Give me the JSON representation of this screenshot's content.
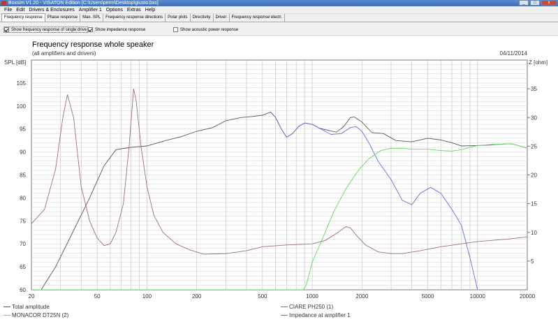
{
  "window": {
    "title": "Boxsim V1.20 - VISATON Edition [C:\\Users\\perm\\Desktop\\giusto.bxs]"
  },
  "menu": [
    "File",
    "Edit",
    "Drivers & Enclosures",
    "Amplifier 1",
    "Options",
    "Extras",
    "Help"
  ],
  "tabs": [
    "Frequency response",
    "Phase response",
    "Max. SPL",
    "Frequency response directions",
    "Polar plots",
    "Directivity",
    "Driver",
    "Frequency response electr."
  ],
  "options": {
    "single_drivers": "Show frequency response of single drive",
    "impedance": "Show impedance response",
    "acoustic_power": "Show acoustic power response"
  },
  "chart": {
    "title": "Frequency response whole speaker",
    "subtitle": "(all amplifiers and drivers)",
    "date": "04/11/2014",
    "ylabel_left": "SPL [dB]",
    "ylabel_right": "Z [ohm]"
  },
  "legend": [
    {
      "name": "Total amplitude",
      "color": "#555555"
    },
    {
      "name": "CIARE PH250 (1)",
      "color": "#6a6adf"
    },
    {
      "name": "MONACOR DT25N (2)",
      "color": "#5fd85f"
    },
    {
      "name": "Impedance at amplifier 1",
      "color": "#a07070"
    }
  ],
  "chart_data": {
    "type": "line",
    "x_scale": "log",
    "xlim": [
      20,
      20000
    ],
    "ylim": [
      60,
      110
    ],
    "y2lim": [
      0,
      40
    ],
    "x_ticks": [
      "20",
      "50",
      "100",
      "200",
      "500",
      "1000",
      "2000",
      "5000",
      "10000",
      "20000"
    ],
    "y_ticks": [
      "60",
      "65",
      "70",
      "75",
      "80",
      "85",
      "90",
      "95",
      "100",
      "105"
    ],
    "y2_ticks": [
      "5",
      "10",
      "15",
      "20",
      "25",
      "30",
      "35"
    ],
    "series": [
      {
        "name": "Total amplitude",
        "axis": "left",
        "color": "#555555",
        "points": [
          [
            22,
            59
          ],
          [
            28,
            65
          ],
          [
            35,
            72
          ],
          [
            45,
            80
          ],
          [
            55,
            87
          ],
          [
            65,
            90.5
          ],
          [
            80,
            91
          ],
          [
            100,
            91.3
          ],
          [
            130,
            92.5
          ],
          [
            160,
            93.3
          ],
          [
            200,
            94.5
          ],
          [
            250,
            95.3
          ],
          [
            300,
            96.8
          ],
          [
            370,
            97.5
          ],
          [
            430,
            97.7
          ],
          [
            500,
            98
          ],
          [
            560,
            98.7
          ],
          [
            600,
            97.5
          ],
          [
            650,
            95
          ],
          [
            700,
            93.2
          ],
          [
            760,
            94
          ],
          [
            830,
            95.6
          ],
          [
            900,
            96.3
          ],
          [
            1000,
            96
          ],
          [
            1100,
            95.2
          ],
          [
            1250,
            94.7
          ],
          [
            1400,
            94.3
          ],
          [
            1550,
            95.5
          ],
          [
            1700,
            97.5
          ],
          [
            1800,
            97.6
          ],
          [
            2000,
            96.5
          ],
          [
            2300,
            94.2
          ],
          [
            2700,
            94
          ],
          [
            3200,
            92.5
          ],
          [
            4000,
            92.2
          ],
          [
            5000,
            93
          ],
          [
            6000,
            92.6
          ],
          [
            7000,
            92
          ],
          [
            8000,
            91.3
          ],
          [
            10000,
            91.4
          ],
          [
            12000,
            91.5
          ],
          [
            14000,
            91.7
          ],
          [
            16000,
            91.8
          ],
          [
            18000,
            91.3
          ],
          [
            20000,
            90.8
          ]
        ]
      },
      {
        "name": "CIARE PH250 (1)",
        "axis": "left",
        "color": "#6a6adf",
        "points": [
          [
            560,
            98.7
          ],
          [
            600,
            97.5
          ],
          [
            650,
            95
          ],
          [
            700,
            93.2
          ],
          [
            760,
            94
          ],
          [
            830,
            95.6
          ],
          [
            900,
            96.3
          ],
          [
            1000,
            96
          ],
          [
            1100,
            95.2
          ],
          [
            1300,
            93.8
          ],
          [
            1500,
            94
          ],
          [
            1700,
            95.3
          ],
          [
            1850,
            95.5
          ],
          [
            2000,
            94.5
          ],
          [
            2200,
            92
          ],
          [
            2500,
            88
          ],
          [
            3000,
            84
          ],
          [
            3500,
            79.5
          ],
          [
            4000,
            78.5
          ],
          [
            4500,
            81
          ],
          [
            5200,
            82.3
          ],
          [
            6000,
            81
          ],
          [
            7000,
            77.5
          ],
          [
            8000,
            74
          ],
          [
            9000,
            67
          ],
          [
            10000,
            60
          ],
          [
            10500,
            59
          ]
        ]
      },
      {
        "name": "MONACOR DT25N (2)",
        "axis": "left",
        "color": "#5fd85f",
        "points": [
          [
            20,
            60
          ],
          [
            880,
            60
          ],
          [
            920,
            61
          ],
          [
            1000,
            66
          ],
          [
            1150,
            71
          ],
          [
            1350,
            77
          ],
          [
            1600,
            82
          ],
          [
            1900,
            86
          ],
          [
            2200,
            88.5
          ],
          [
            2600,
            90.3
          ],
          [
            3000,
            90.8
          ],
          [
            3500,
            90.8
          ],
          [
            4000,
            90.6
          ],
          [
            5000,
            90.6
          ],
          [
            6000,
            90.3
          ],
          [
            7000,
            90.2
          ],
          [
            8000,
            90.5
          ],
          [
            9000,
            91
          ],
          [
            10000,
            91.4
          ],
          [
            12000,
            91.6
          ],
          [
            14000,
            91.7
          ],
          [
            16000,
            91.8
          ],
          [
            18000,
            91.3
          ],
          [
            20000,
            90.8
          ]
        ]
      },
      {
        "name": "Impedance at amplifier 1",
        "axis": "right",
        "color": "#a07070",
        "points": [
          [
            20,
            11.5
          ],
          [
            24,
            14
          ],
          [
            28,
            21
          ],
          [
            31,
            30
          ],
          [
            33,
            34
          ],
          [
            36,
            30
          ],
          [
            40,
            18
          ],
          [
            45,
            12
          ],
          [
            50,
            9
          ],
          [
            55,
            7.7
          ],
          [
            60,
            8
          ],
          [
            65,
            10
          ],
          [
            72,
            15
          ],
          [
            78,
            25
          ],
          [
            83,
            35
          ],
          [
            86,
            33
          ],
          [
            92,
            25
          ],
          [
            100,
            18
          ],
          [
            110,
            13
          ],
          [
            125,
            10
          ],
          [
            150,
            8
          ],
          [
            180,
            7
          ],
          [
            220,
            6.2
          ],
          [
            300,
            6.3
          ],
          [
            400,
            6.8
          ],
          [
            500,
            7.5
          ],
          [
            700,
            7.8
          ],
          [
            1000,
            8
          ],
          [
            1200,
            8.6
          ],
          [
            1400,
            9.8
          ],
          [
            1600,
            11
          ],
          [
            1700,
            10.8
          ],
          [
            1850,
            9.5
          ],
          [
            2100,
            7.8
          ],
          [
            2500,
            6.6
          ],
          [
            3000,
            6.3
          ],
          [
            3500,
            6.3
          ],
          [
            4500,
            6.8
          ],
          [
            6000,
            7.5
          ],
          [
            8000,
            8
          ],
          [
            10000,
            8.4
          ],
          [
            15000,
            8.8
          ],
          [
            20000,
            9.2
          ]
        ]
      }
    ]
  }
}
